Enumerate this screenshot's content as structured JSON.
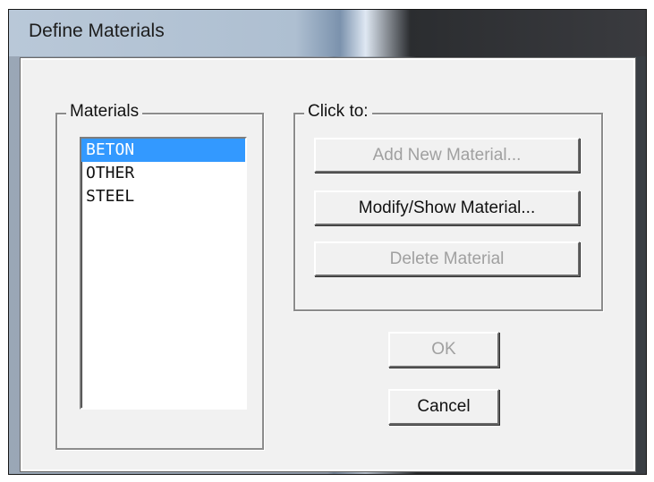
{
  "window": {
    "title": "Define Materials"
  },
  "materials_group": {
    "label": "Materials",
    "items": [
      {
        "label": "BETON",
        "selected": true
      },
      {
        "label": "OTHER",
        "selected": false
      },
      {
        "label": "STEEL",
        "selected": false
      }
    ]
  },
  "click_to_group": {
    "label": "Click to:",
    "add_new_label": "Add New Material...",
    "add_new_enabled": false,
    "modify_show_label": "Modify/Show Material...",
    "modify_show_enabled": true,
    "delete_label": "Delete Material",
    "delete_enabled": false
  },
  "footer": {
    "ok_label": "OK",
    "ok_enabled": false,
    "cancel_label": "Cancel",
    "cancel_enabled": true
  },
  "colors": {
    "selection": "#3399ff",
    "dialog_background": "#f1f1f1",
    "disabled_text": "#a0a0a0"
  }
}
